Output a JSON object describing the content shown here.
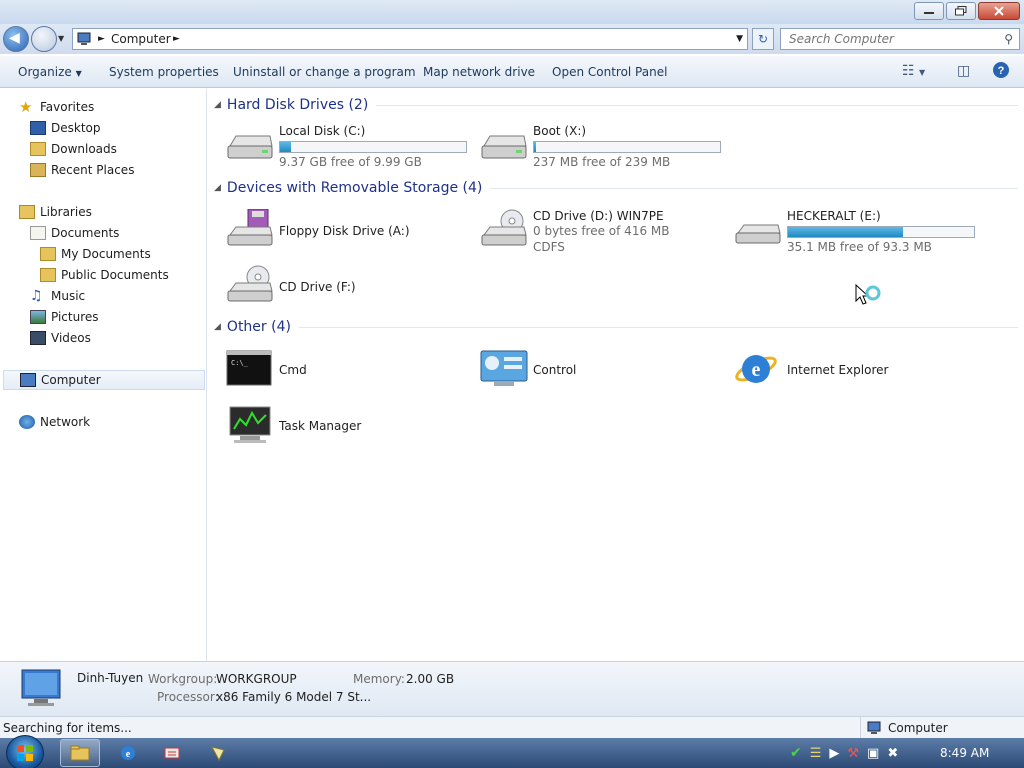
{
  "window": {
    "controls": [
      "minimize",
      "restore",
      "close"
    ]
  },
  "address": {
    "path": "Computer",
    "search_placeholder": "Search Computer"
  },
  "toolbar": {
    "organize": "Organize",
    "system_properties": "System properties",
    "uninstall": "Uninstall or change a program",
    "map_drive": "Map network drive",
    "control_panel": "Open Control Panel"
  },
  "nav": {
    "favorites": "Favorites",
    "desktop": "Desktop",
    "downloads": "Downloads",
    "recent_places": "Recent Places",
    "libraries": "Libraries",
    "documents": "Documents",
    "my_documents": "My Documents",
    "public_documents": "Public Documents",
    "music": "Music",
    "pictures": "Pictures",
    "videos": "Videos",
    "computer": "Computer",
    "network": "Network"
  },
  "groups": {
    "hard_disks": {
      "title": "Hard Disk Drives (2)",
      "items": [
        {
          "name": "Local Disk (C:)",
          "free": "9.37 GB free of 9.99 GB",
          "used_fraction": 0.06
        },
        {
          "name": "Boot (X:)",
          "free": "237 MB free of 239 MB",
          "used_fraction": 0.01
        }
      ]
    },
    "removable": {
      "title": "Devices with Removable Storage (4)",
      "items": [
        {
          "name": "Floppy Disk Drive (A:)"
        },
        {
          "name": "CD Drive (D:) WIN7PE",
          "free": "0 bytes free of 416 MB",
          "fs": "CDFS"
        },
        {
          "name": "HECKERALT (E:)",
          "free": "35.1 MB free of 93.3 MB",
          "used_fraction": 0.62
        },
        {
          "name": "CD Drive (F:)"
        }
      ]
    },
    "other": {
      "title": "Other (4)",
      "items": [
        {
          "name": "Cmd"
        },
        {
          "name": "Control"
        },
        {
          "name": "Internet Explorer"
        },
        {
          "name": "Task Manager"
        }
      ]
    }
  },
  "details": {
    "computer_name": "Dinh-Tuyen",
    "workgroup_label": "Workgroup:",
    "workgroup": "WORKGROUP",
    "memory_label": "Memory:",
    "memory": "2.00 GB",
    "processor_label": "Processor:",
    "processor": "x86 Family 6 Model 7 St..."
  },
  "status": {
    "left": "Searching for items...",
    "right": "Computer"
  },
  "taskbar": {
    "clock": "8:49 AM"
  },
  "colors": {
    "accent": "#1e3287",
    "bar_fill": "#1f8ac2",
    "taskbar": "#3a5a85"
  }
}
